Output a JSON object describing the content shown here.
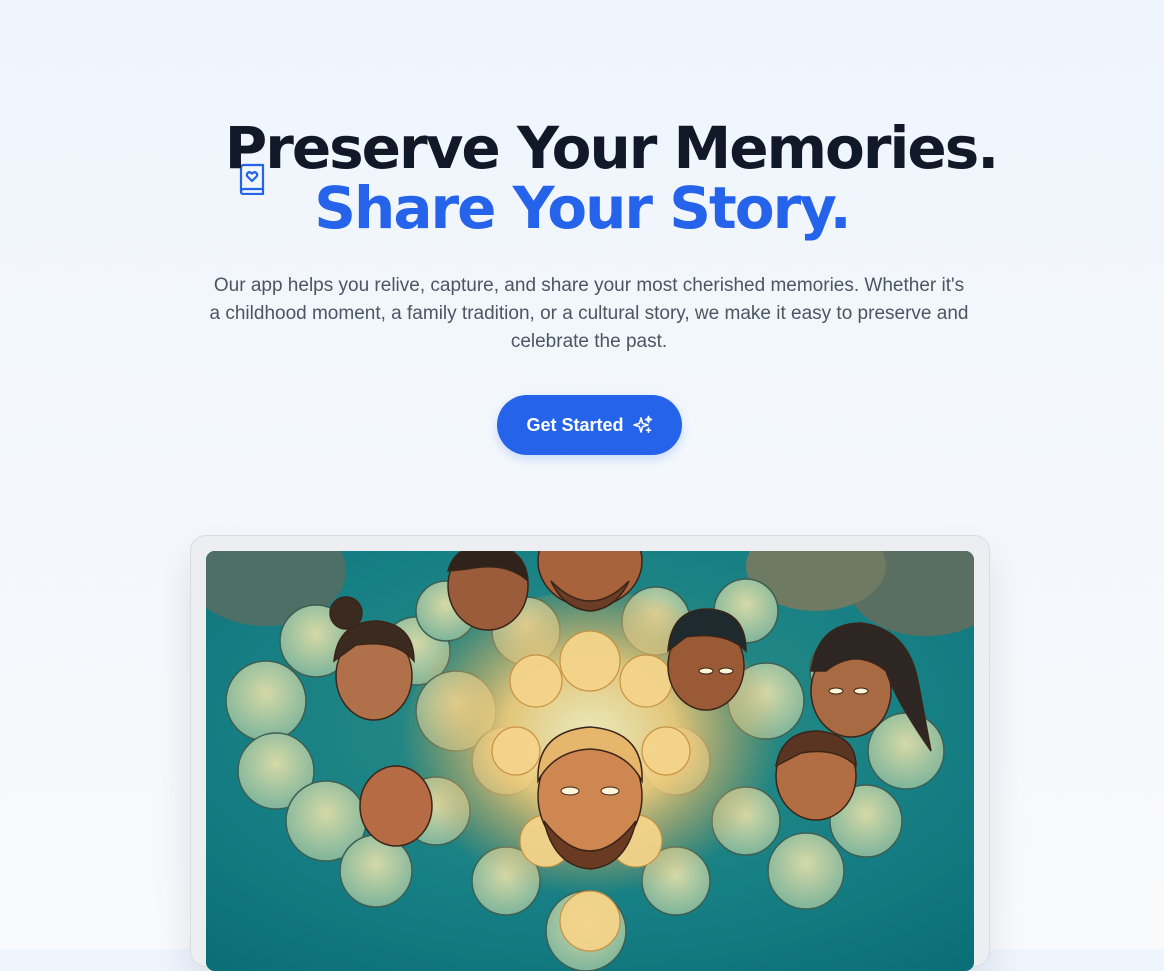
{
  "hero": {
    "title_line1": "Preserve Your Memories.",
    "title_line2": "Share Your Story.",
    "subtitle": "Our app helps you relive, capture, and share your most cherished memories. Whether it's a childhood moment, a family tradition, or a cultural story, we make it easy to preserve and celebrate the past.",
    "cta_label": "Get Started",
    "icons": {
      "title": "book-heart-icon",
      "cta": "sparkles-icon"
    },
    "colors": {
      "accent": "#2563eb",
      "heading": "#111827",
      "body_text": "#4b5563",
      "background": "#eff5fd"
    }
  },
  "showcase": {
    "image": "illustration-family-faces-around-glowing-clouds"
  }
}
